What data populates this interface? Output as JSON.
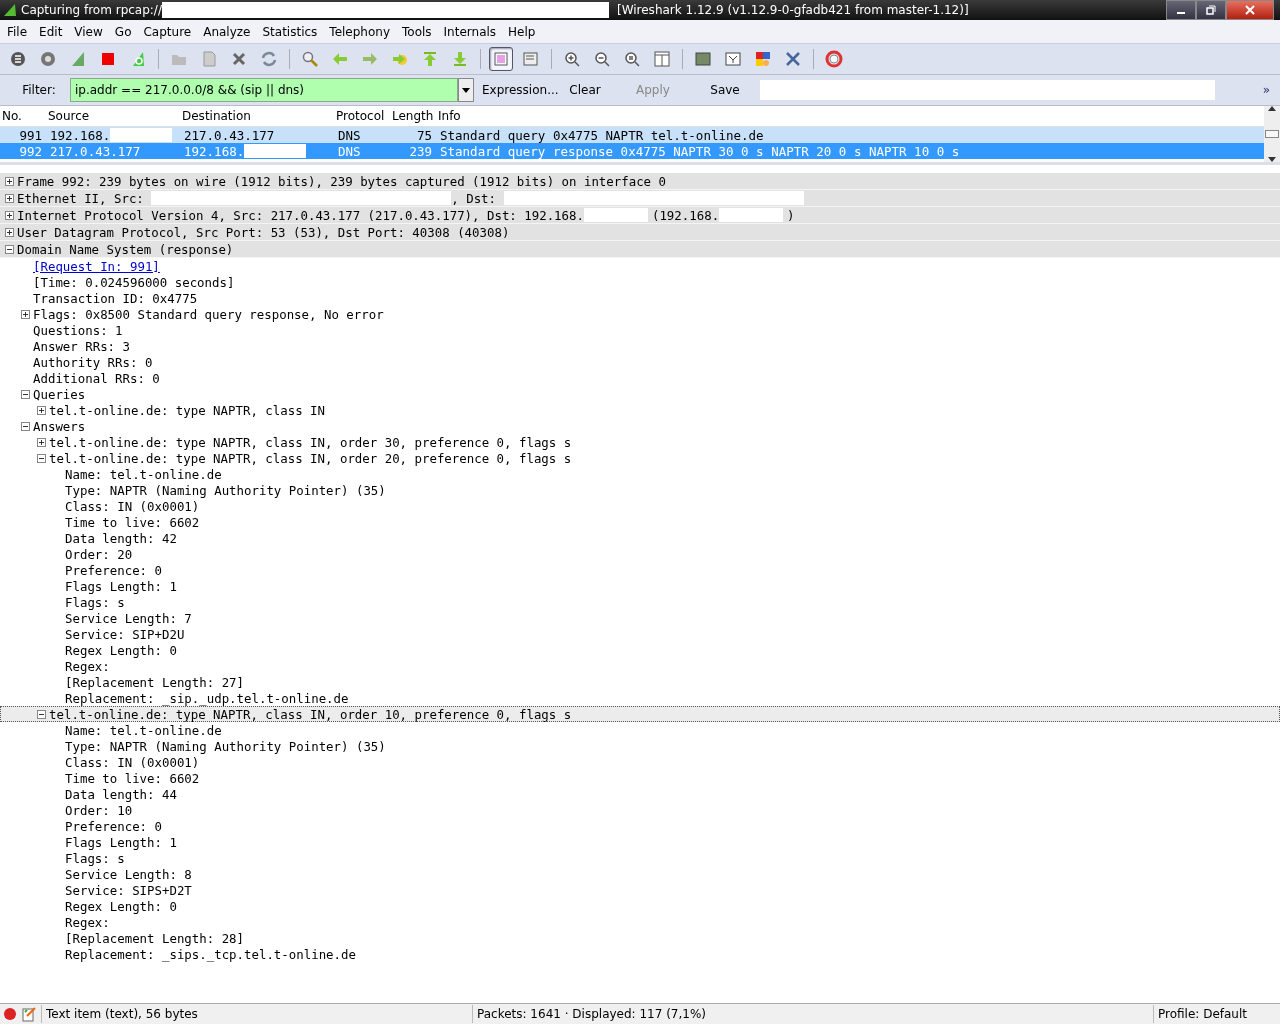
{
  "window": {
    "title_prefix": "Capturing from rpcap://",
    "title_suffix": "[Wireshark 1.12.9  (v1.12.9-0-gfadb421 from master-1.12)]"
  },
  "menu": [
    "File",
    "Edit",
    "View",
    "Go",
    "Capture",
    "Analyze",
    "Statistics",
    "Telephony",
    "Tools",
    "Internals",
    "Help"
  ],
  "toolbar": [
    [
      {
        "kind": "interfaces",
        "pressed": false
      },
      {
        "kind": "options",
        "pressed": false
      },
      {
        "kind": "start",
        "pressed": false
      },
      {
        "kind": "stop",
        "pressed": false
      },
      {
        "kind": "restart",
        "pressed": false
      }
    ],
    [
      {
        "kind": "open",
        "pressed": false
      },
      {
        "kind": "save",
        "pressed": false
      },
      {
        "kind": "close",
        "pressed": false
      },
      {
        "kind": "reload",
        "pressed": false
      }
    ],
    [
      {
        "kind": "find",
        "pressed": false
      },
      {
        "kind": "back",
        "pressed": false
      },
      {
        "kind": "forward",
        "pressed": false
      },
      {
        "kind": "goto",
        "pressed": false
      },
      {
        "kind": "first",
        "pressed": false
      },
      {
        "kind": "last",
        "pressed": false
      }
    ],
    [
      {
        "kind": "colorize",
        "pressed": true
      },
      {
        "kind": "autoscroll",
        "pressed": false
      }
    ],
    [
      {
        "kind": "zoomin",
        "pressed": false
      },
      {
        "kind": "zoomout",
        "pressed": false
      },
      {
        "kind": "zoomreset",
        "pressed": false
      },
      {
        "kind": "resize",
        "pressed": false
      }
    ],
    [
      {
        "kind": "capfilter",
        "pressed": false
      },
      {
        "kind": "dispfilter",
        "pressed": false
      },
      {
        "kind": "coloring",
        "pressed": false
      },
      {
        "kind": "prefs",
        "pressed": false
      }
    ],
    [
      {
        "kind": "help",
        "pressed": false
      }
    ]
  ],
  "filter": {
    "label": "Filter:",
    "value": "ip.addr == 217.0.0.0/8 && (sip || dns)",
    "buttons": [
      {
        "label": "Expression...",
        "disabled": false
      },
      {
        "label": "Clear",
        "disabled": false
      },
      {
        "label": "Apply",
        "disabled": true
      },
      {
        "label": "Save",
        "disabled": false
      }
    ],
    "more": "»"
  },
  "packet_list": {
    "columns": [
      "No.",
      "Source",
      "Destination",
      "Protocol",
      "Length",
      "Info"
    ],
    "rows": [
      {
        "selected": false,
        "cells": [
          "991",
          {
            "text": "192.168.",
            "redacted": true
          },
          "217.0.43.177",
          "DNS",
          "75",
          "Standard query 0x4775  NAPTR tel.t-online.de"
        ]
      },
      {
        "selected": true,
        "cells": [
          "992",
          "217.0.43.177",
          {
            "text": "192.168.",
            "redacted": true
          },
          "DNS",
          "239",
          "Standard query response 0x4775  NAPTR 30 0 s NAPTR 20 0 s NAPTR 10 0 s"
        ]
      }
    ]
  },
  "details": [
    {
      "expanded": false,
      "selected": false,
      "parts": [
        {
          "kind": "text",
          "text": "Frame 992: 239 bytes on wire (1912 bits), 239 bytes captured (1912 bits) on interface 0"
        }
      ]
    },
    {
      "expanded": false,
      "selected": false,
      "parts": [
        {
          "kind": "text",
          "text": "Ethernet II, Src: "
        },
        {
          "kind": "redacted-mac"
        },
        {
          "kind": "text",
          "text": ", Dst: "
        },
        {
          "kind": "redacted-mac"
        }
      ]
    },
    {
      "expanded": false,
      "selected": false,
      "parts": [
        {
          "kind": "text",
          "text": "Internet Protocol Version 4, Src: 217.0.43.177 (217.0.43.177), Dst: 192.168."
        },
        {
          "kind": "redacted-ip"
        },
        {
          "kind": "text",
          "text": "(192.168."
        },
        {
          "kind": "redacted-ip"
        },
        {
          "kind": "text",
          "text": ")"
        }
      ]
    },
    {
      "expanded": false,
      "selected": false,
      "parts": [
        {
          "kind": "text",
          "text": "User Datagram Protocol, Src Port: 53 (53), Dst Port: 40308 (40308)"
        }
      ]
    },
    {
      "expanded": true,
      "selected": false,
      "parts": [
        {
          "kind": "text",
          "text": "Domain Name System (response)"
        }
      ],
      "children": [
        {
          "selected": false,
          "parts": [
            {
              "kind": "link",
              "text": "[Request In: 991]"
            }
          ]
        },
        {
          "selected": false,
          "parts": [
            {
              "kind": "text",
              "text": "[Time: 0.024596000 seconds]"
            }
          ]
        },
        {
          "selected": false,
          "parts": [
            {
              "kind": "text",
              "text": "Transaction ID: 0x4775"
            }
          ]
        },
        {
          "expanded": false,
          "selected": false,
          "parts": [
            {
              "kind": "text",
              "text": "Flags: 0x8500 Standard query response, No error"
            }
          ]
        },
        {
          "selected": false,
          "parts": [
            {
              "kind": "text",
              "text": "Questions: 1"
            }
          ]
        },
        {
          "selected": false,
          "parts": [
            {
              "kind": "text",
              "text": "Answer RRs: 3"
            }
          ]
        },
        {
          "selected": false,
          "parts": [
            {
              "kind": "text",
              "text": "Authority RRs: 0"
            }
          ]
        },
        {
          "selected": false,
          "parts": [
            {
              "kind": "text",
              "text": "Additional RRs: 0"
            }
          ]
        },
        {
          "expanded": true,
          "selected": false,
          "parts": [
            {
              "kind": "text",
              "text": "Queries"
            }
          ],
          "children": [
            {
              "expanded": false,
              "selected": false,
              "parts": [
                {
                  "kind": "text",
                  "text": "tel.t-online.de: type NAPTR, class IN"
                }
              ]
            }
          ]
        },
        {
          "expanded": true,
          "selected": false,
          "parts": [
            {
              "kind": "text",
              "text": "Answers"
            }
          ],
          "children": [
            {
              "expanded": false,
              "selected": false,
              "parts": [
                {
                  "kind": "text",
                  "text": "tel.t-online.de: type NAPTR, class IN, order 30, preference 0, flags s"
                }
              ]
            },
            {
              "expanded": true,
              "selected": false,
              "parts": [
                {
                  "kind": "text",
                  "text": "tel.t-online.de: type NAPTR, class IN, order 20, preference 0, flags s"
                }
              ],
              "children": [
                {
                  "selected": false,
                  "parts": [
                    {
                      "kind": "text",
                      "text": "Name: tel.t-online.de"
                    }
                  ]
                },
                {
                  "selected": false,
                  "parts": [
                    {
                      "kind": "text",
                      "text": "Type: NAPTR (Naming Authority Pointer) (35)"
                    }
                  ]
                },
                {
                  "selected": false,
                  "parts": [
                    {
                      "kind": "text",
                      "text": "Class: IN (0x0001)"
                    }
                  ]
                },
                {
                  "selected": false,
                  "parts": [
                    {
                      "kind": "text",
                      "text": "Time to live: 6602"
                    }
                  ]
                },
                {
                  "selected": false,
                  "parts": [
                    {
                      "kind": "text",
                      "text": "Data length: 42"
                    }
                  ]
                },
                {
                  "selected": false,
                  "parts": [
                    {
                      "kind": "text",
                      "text": "Order: 20"
                    }
                  ]
                },
                {
                  "selected": false,
                  "parts": [
                    {
                      "kind": "text",
                      "text": "Preference: 0"
                    }
                  ]
                },
                {
                  "selected": false,
                  "parts": [
                    {
                      "kind": "text",
                      "text": "Flags Length: 1"
                    }
                  ]
                },
                {
                  "selected": false,
                  "parts": [
                    {
                      "kind": "text",
                      "text": "Flags: s"
                    }
                  ]
                },
                {
                  "selected": false,
                  "parts": [
                    {
                      "kind": "text",
                      "text": "Service Length: 7"
                    }
                  ]
                },
                {
                  "selected": false,
                  "parts": [
                    {
                      "kind": "text",
                      "text": "Service: SIP+D2U"
                    }
                  ]
                },
                {
                  "selected": false,
                  "parts": [
                    {
                      "kind": "text",
                      "text": "Regex Length: 0"
                    }
                  ]
                },
                {
                  "selected": false,
                  "parts": [
                    {
                      "kind": "text",
                      "text": "Regex:"
                    }
                  ]
                },
                {
                  "selected": false,
                  "parts": [
                    {
                      "kind": "text",
                      "text": "[Replacement Length: 27]"
                    }
                  ]
                },
                {
                  "selected": false,
                  "parts": [
                    {
                      "kind": "text",
                      "text": "Replacement: _sip._udp.tel.t-online.de"
                    }
                  ]
                }
              ]
            },
            {
              "expanded": true,
              "selected": true,
              "parts": [
                {
                  "kind": "text",
                  "text": "tel.t-online.de: type NAPTR, class IN, order 10, preference 0, flags s"
                }
              ],
              "children": [
                {
                  "selected": false,
                  "parts": [
                    {
                      "kind": "text",
                      "text": "Name: tel.t-online.de"
                    }
                  ]
                },
                {
                  "selected": false,
                  "parts": [
                    {
                      "kind": "text",
                      "text": "Type: NAPTR (Naming Authority Pointer) (35)"
                    }
                  ]
                },
                {
                  "selected": false,
                  "parts": [
                    {
                      "kind": "text",
                      "text": "Class: IN (0x0001)"
                    }
                  ]
                },
                {
                  "selected": false,
                  "parts": [
                    {
                      "kind": "text",
                      "text": "Time to live: 6602"
                    }
                  ]
                },
                {
                  "selected": false,
                  "parts": [
                    {
                      "kind": "text",
                      "text": "Data length: 44"
                    }
                  ]
                },
                {
                  "selected": false,
                  "parts": [
                    {
                      "kind": "text",
                      "text": "Order: 10"
                    }
                  ]
                },
                {
                  "selected": false,
                  "parts": [
                    {
                      "kind": "text",
                      "text": "Preference: 0"
                    }
                  ]
                },
                {
                  "selected": false,
                  "parts": [
                    {
                      "kind": "text",
                      "text": "Flags Length: 1"
                    }
                  ]
                },
                {
                  "selected": false,
                  "parts": [
                    {
                      "kind": "text",
                      "text": "Flags: s"
                    }
                  ]
                },
                {
                  "selected": false,
                  "parts": [
                    {
                      "kind": "text",
                      "text": "Service Length: 8"
                    }
                  ]
                },
                {
                  "selected": false,
                  "parts": [
                    {
                      "kind": "text",
                      "text": "Service: SIPS+D2T"
                    }
                  ]
                },
                {
                  "selected": false,
                  "parts": [
                    {
                      "kind": "text",
                      "text": "Regex Length: 0"
                    }
                  ]
                },
                {
                  "selected": false,
                  "parts": [
                    {
                      "kind": "text",
                      "text": "Regex:"
                    }
                  ]
                },
                {
                  "selected": false,
                  "parts": [
                    {
                      "kind": "text",
                      "text": "[Replacement Length: 28]"
                    }
                  ]
                },
                {
                  "selected": false,
                  "parts": [
                    {
                      "kind": "text",
                      "text": "Replacement: _sips._tcp.tel.t-online.de"
                    }
                  ]
                }
              ]
            }
          ]
        }
      ]
    }
  ],
  "status_bar": {
    "capturing": true,
    "item": "Text item (text), 56 bytes",
    "packets": "Packets: 1641 · Displayed: 117 (7,1%)",
    "profile": "Profile: Default"
  }
}
